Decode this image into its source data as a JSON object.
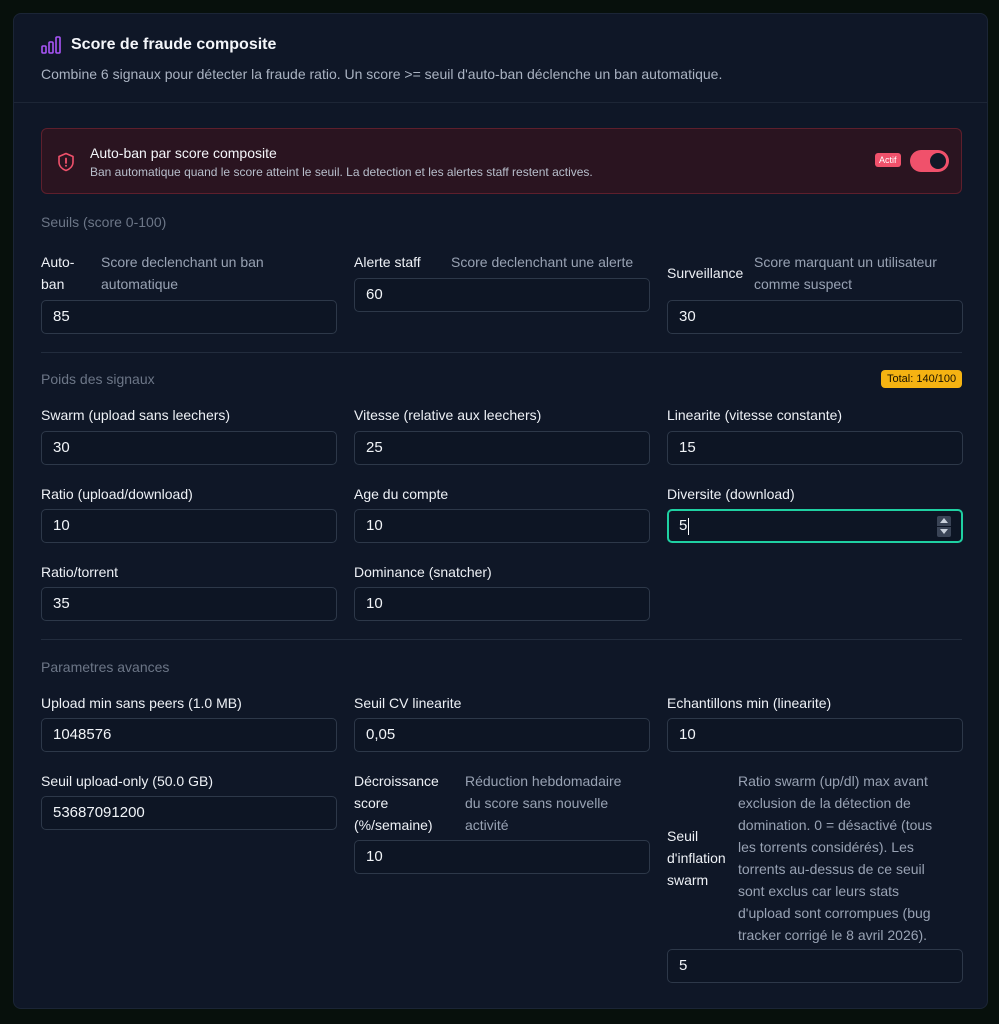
{
  "header": {
    "title": "Score de fraude composite",
    "subtitle": "Combine 6 signaux pour détecter la fraude ratio. Un score >= seuil d'auto-ban déclenche un ban automatique."
  },
  "autoban": {
    "title": "Auto-ban par score composite",
    "description": "Ban automatique quand le score atteint le seuil. La detection et les alertes staff restent actives.",
    "status_badge": "Actif",
    "enabled": true
  },
  "thresholds": {
    "section_title": "Seuils (score 0-100)",
    "autoban": {
      "label_line1": "Auto-",
      "label_line2": "ban",
      "help_line1": "Score declenchant un ban",
      "help_line2": "automatique",
      "value": "85"
    },
    "alert": {
      "label": "Alerte staff",
      "help": "Score declenchant une alerte",
      "value": "60"
    },
    "watch": {
      "label": "Surveillance",
      "help_line1": "Score marquant un utilisateur",
      "help_line2": "comme suspect",
      "value": "30"
    }
  },
  "weights": {
    "section_title": "Poids des signaux",
    "total_badge": "Total: 140/100",
    "fields": [
      {
        "label": "Swarm (upload sans leechers)",
        "value": "30"
      },
      {
        "label": "Vitesse (relative aux leechers)",
        "value": "25"
      },
      {
        "label": "Linearite (vitesse constante)",
        "value": "15"
      },
      {
        "label": "Ratio (upload/download)",
        "value": "10"
      },
      {
        "label": "Age du compte",
        "value": "10"
      },
      {
        "label": "Diversite (download)",
        "value": "5"
      },
      {
        "label": "Ratio/torrent",
        "value": "35"
      },
      {
        "label": "Dominance (snatcher)",
        "value": "10"
      }
    ]
  },
  "advanced": {
    "section_title": "Parametres avances",
    "upload_min": {
      "label": "Upload min sans peers (1.0 MB)",
      "value": "1048576"
    },
    "cv_threshold": {
      "label": "Seuil CV linearite",
      "value": "0,05"
    },
    "min_samples": {
      "label": "Echantillons min (linearite)",
      "value": "10"
    },
    "upload_only": {
      "label": "Seuil upload-only (50.0 GB)",
      "value": "53687091200"
    },
    "decay": {
      "label_lines": [
        "Décroissance",
        "score",
        "(%/semaine)"
      ],
      "help_lines": [
        "Réduction hebdomadaire",
        "du score sans nouvelle",
        "activité"
      ],
      "value": "10"
    },
    "swarm_inflation": {
      "label_lines": [
        "Seuil",
        "d'inflation",
        "swarm"
      ],
      "help_lines": [
        "Ratio swarm (up/dl) max avant",
        "exclusion de la détection de",
        "domination. 0 = désactivé (tous",
        "les torrents considérés). Les",
        "torrents au-dessus de ce seuil",
        "sont exclus car leurs stats",
        "d'upload sont corrompues (bug",
        "tracker corrigé le 8 avril 2026)."
      ],
      "value": "5"
    }
  },
  "colors": {
    "accent": "#1fd0a2",
    "danger": "#f0516b",
    "warning": "#f5b312",
    "icon": "#a855f7"
  }
}
